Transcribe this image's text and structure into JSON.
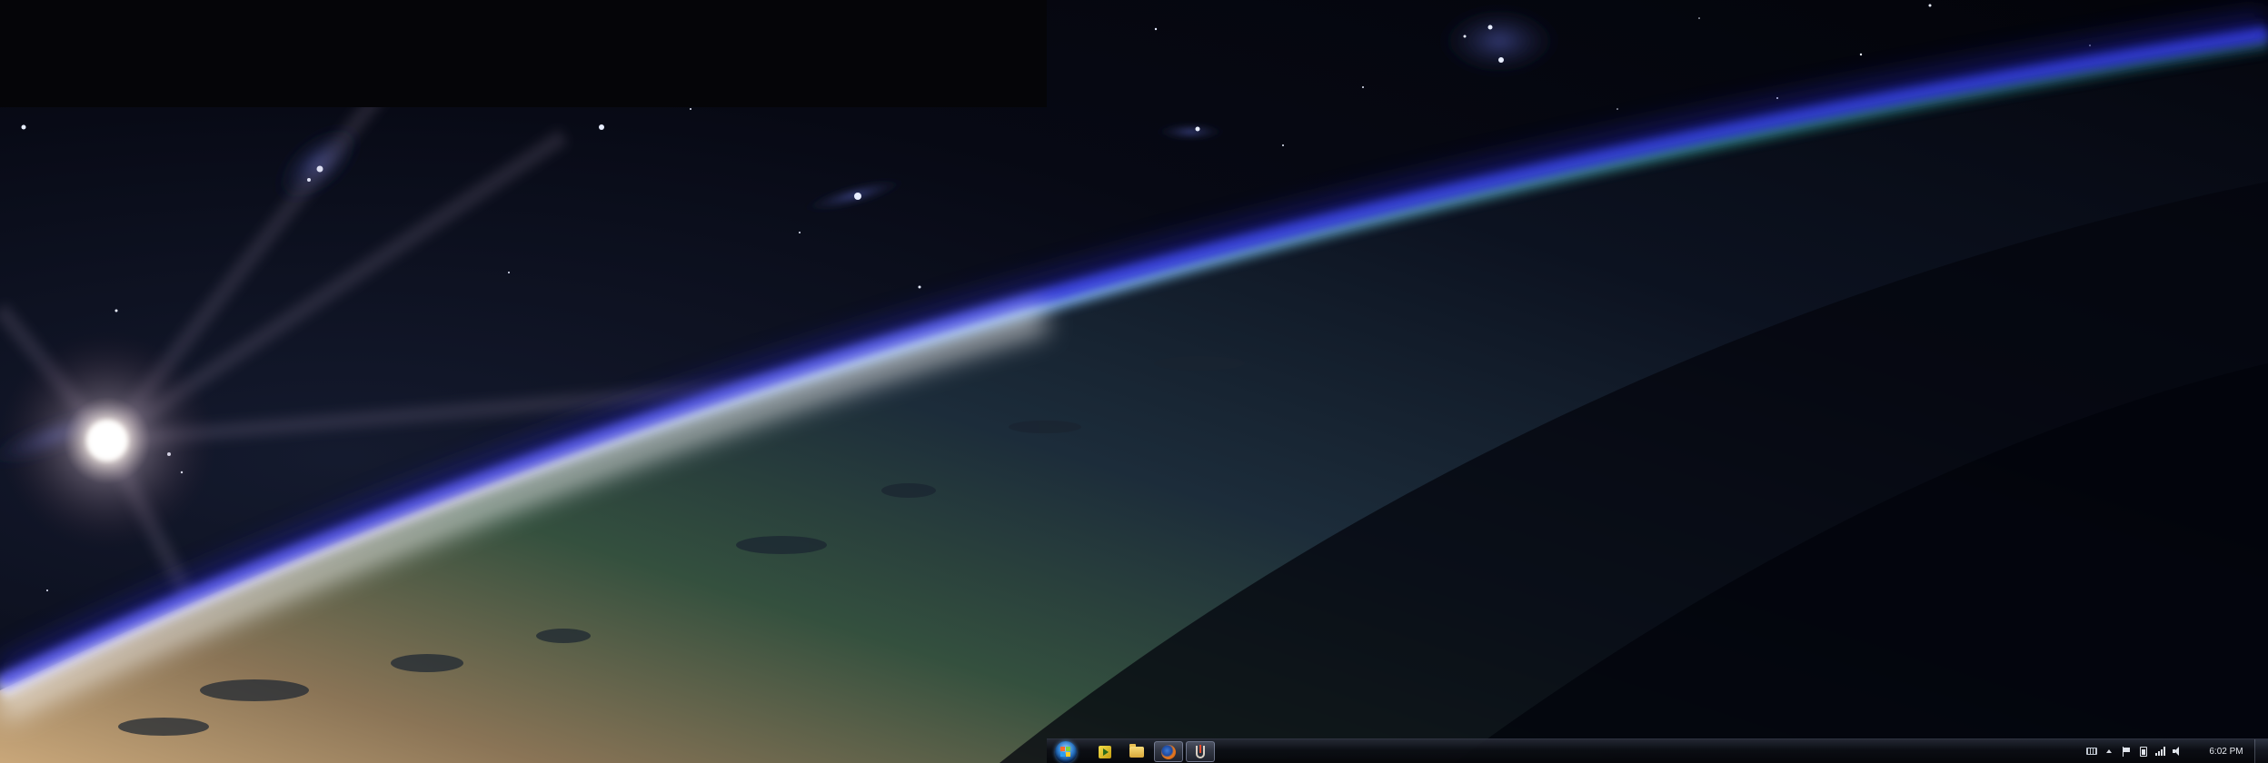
{
  "taskbar": {
    "start": {
      "icon": "windows-start-orb-icon"
    },
    "pinned": [
      {
        "name": "media-player",
        "icon": "media-player-icon"
      },
      {
        "name": "explorer",
        "icon": "folder-icon"
      },
      {
        "name": "firefox",
        "icon": "firefox-icon",
        "active": true
      },
      {
        "name": "app",
        "icon": "app-icon"
      }
    ],
    "tray": {
      "icons": [
        "keyboard-icon",
        "show-hidden-icons-arrow",
        "action-center-flag-icon",
        "power-icon",
        "network-signal-icon",
        "volume-icon"
      ],
      "clock": "6:02 PM"
    }
  },
  "colors": {
    "atmosphere": "#3a3cff",
    "space": "#04050c",
    "taskbar": "#0c0e14"
  }
}
